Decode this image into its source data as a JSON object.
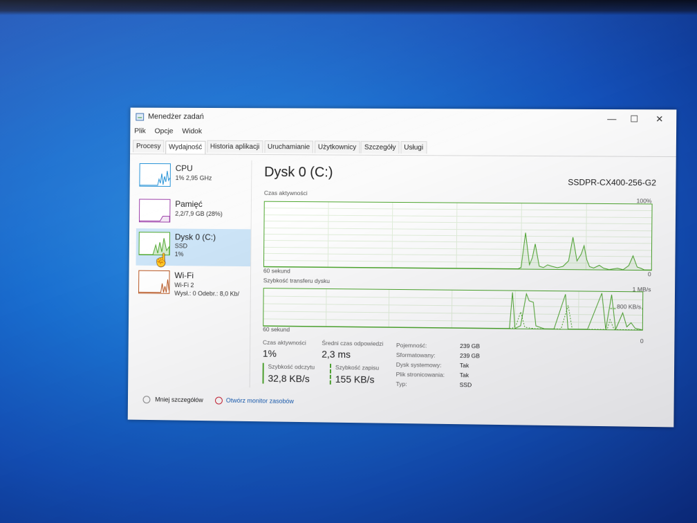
{
  "window": {
    "title": "Menedżer zadań"
  },
  "menu": [
    "Plik",
    "Opcje",
    "Widok"
  ],
  "tabs": [
    "Procesy",
    "Wydajność",
    "Historia aplikacji",
    "Uruchamianie",
    "Użytkownicy",
    "Szczegóły",
    "Usługi"
  ],
  "active_tab": "Wydajność",
  "sidebar": {
    "items": [
      {
        "name": "CPU",
        "lines": [
          "1% 2,95 GHz"
        ],
        "color": "#1f8fd6"
      },
      {
        "name": "Pamięć",
        "lines": [
          "2,2/7,9 GB (28%)"
        ],
        "color": "#9b3ca8"
      },
      {
        "name": "Dysk 0 (C:)",
        "lines": [
          "SSD",
          "1%"
        ],
        "color": "#4ea72e"
      },
      {
        "name": "Wi-Fi",
        "lines": [
          "Wi-Fi 2",
          "Wysł.: 0 Odebr.: 8,0 Kb/"
        ],
        "color": "#b8541e"
      }
    ],
    "selected": "Dysk 0 (C:)"
  },
  "main": {
    "title": "Dysk 0 (C:)",
    "model": "SSDPR-CX400-256-G2",
    "active_time_graph": {
      "label": "Czas aktywności",
      "max": "100%",
      "time_span": "60 sekund",
      "min": "0"
    },
    "transfer_graph": {
      "label": "Szybkość transferu dysku",
      "max": "1 MB/s",
      "mid": "800 KB/s",
      "time_span": "60 sekund",
      "min": "0"
    },
    "stats": {
      "active_time": {
        "label": "Czas aktywności",
        "value": "1%"
      },
      "avg_response": {
        "label": "Średni czas odpowiedzi",
        "value": "2,3 ms"
      },
      "read_speed": {
        "label": "Szybkość odczytu",
        "value": "32,8 KB/s"
      },
      "write_speed": {
        "label": "Szybkość zapisu",
        "value": "155 KB/s"
      }
    },
    "properties": [
      {
        "key": "Pojemność:",
        "value": "239 GB"
      },
      {
        "key": "Sformatowany:",
        "value": "239 GB"
      },
      {
        "key": "Dysk systemowy:",
        "value": "Tak"
      },
      {
        "key": "Plik stronicowania:",
        "value": "Tak"
      },
      {
        "key": "Typ:",
        "value": "SSD"
      }
    ]
  },
  "footer": {
    "less_details": "Mniej szczegółów",
    "resource_monitor": "Otwórz monitor zasobów"
  },
  "colors": {
    "disk_green": "#4ea72e",
    "link_blue": "#1a5fb4"
  }
}
